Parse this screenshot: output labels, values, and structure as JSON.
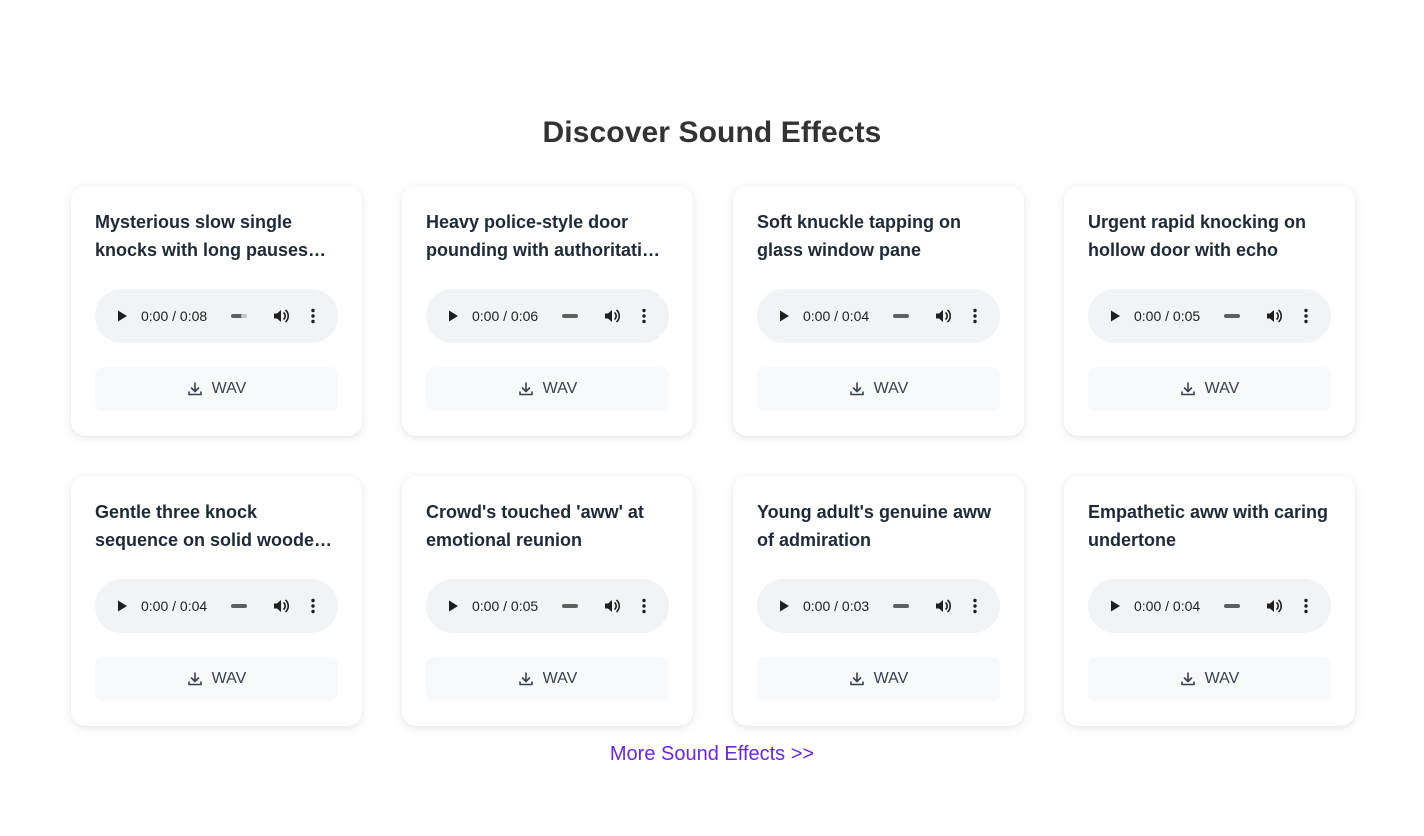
{
  "page": {
    "title": "Discover Sound Effects",
    "more_link": "More Sound Effects >>"
  },
  "cards": [
    {
      "title": "Mysterious slow single knocks with long pauses between",
      "time": "0:00 / 0:08",
      "download_label": "WAV"
    },
    {
      "title": "Heavy police-style door pounding with authoritative force",
      "time": "0:00 / 0:06",
      "download_label": "WAV"
    },
    {
      "title": "Soft knuckle tapping on glass window pane",
      "time": "0:00 / 0:04",
      "download_label": "WAV"
    },
    {
      "title": "Urgent rapid knocking on hollow door with echo",
      "time": "0:00 / 0:05",
      "download_label": "WAV"
    },
    {
      "title": "Gentle three knock sequence on solid wooden door",
      "time": "0:00 / 0:04",
      "download_label": "WAV"
    },
    {
      "title": "Crowd's touched 'aww' at emotional reunion",
      "time": "0:00 / 0:05",
      "download_label": "WAV"
    },
    {
      "title": "Young adult's genuine aww of admiration",
      "time": "0:00 / 0:03",
      "download_label": "WAV"
    },
    {
      "title": "Empathetic aww with caring undertone",
      "time": "0:00 / 0:04",
      "download_label": "WAV"
    }
  ],
  "icons": {
    "play": "play-icon",
    "volume": "volume-icon",
    "more": "more-vertical-icon",
    "download": "download-icon"
  },
  "colors": {
    "link": "#6d28d9",
    "player_bg": "#f1f3f4",
    "button_bg": "#f8f9fb"
  }
}
